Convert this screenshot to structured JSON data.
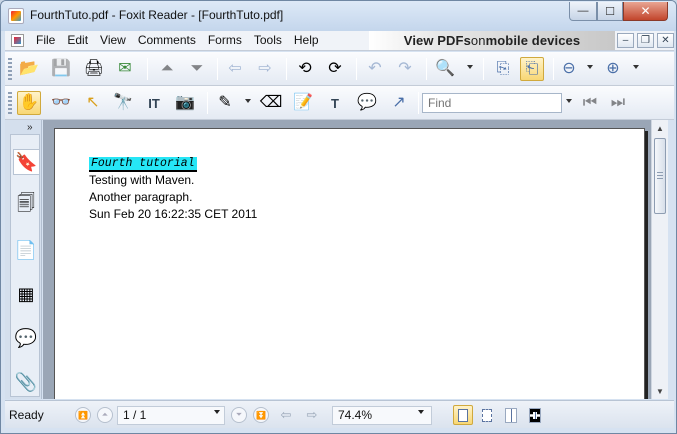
{
  "window": {
    "title": "FourthTuto.pdf - Foxit Reader - [FourthTuto.pdf]",
    "min_glyph": "—",
    "max_glyph": "☐",
    "close_glyph": "✕"
  },
  "menu": {
    "items": [
      "File",
      "Edit",
      "View",
      "Comments",
      "Forms",
      "Tools",
      "Help"
    ],
    "ad_bold_1": "View PDFs ",
    "ad_light": "on",
    "ad_bold_2": " mobile devices",
    "doc_min": "–",
    "doc_restore": "❐",
    "doc_close": "✕"
  },
  "toolbar2": {
    "find_placeholder": "Find"
  },
  "document": {
    "heading": "Fourth tutorial",
    "lines": [
      "Testing with Maven.",
      "Another paragraph.",
      "Sun Feb 20 16:22:35 CET 2011"
    ]
  },
  "statusbar": {
    "status": "Ready",
    "page": "1 / 1",
    "zoom": "74.4%"
  },
  "icons": {
    "open": "folder-open-icon",
    "save": "save-icon",
    "print": "print-icon",
    "email": "email-icon",
    "hand": "hand-icon",
    "zoom_in": "zoom-in-icon"
  },
  "colors": {
    "heading_highlight": "#26e6f6",
    "frame": "#d6e2f1",
    "doc_background": "#9aa6b6"
  }
}
